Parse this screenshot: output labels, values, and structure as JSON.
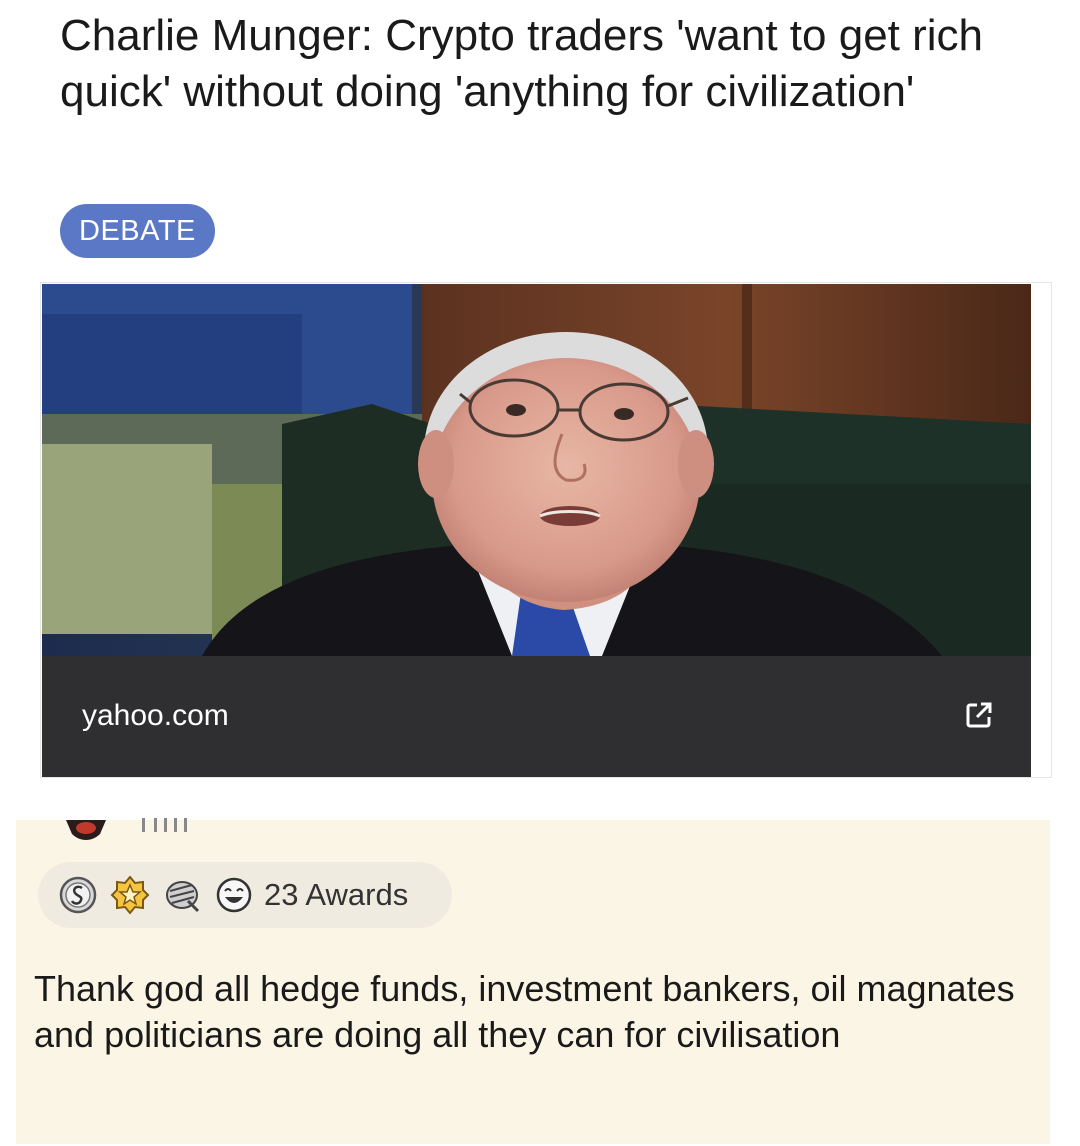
{
  "post": {
    "title": "Charlie Munger: Crypto traders 'want to get rich quick' without doing 'anything for civilization'",
    "flair": "DEBATE",
    "link": {
      "domain": "yahoo.com",
      "external_icon": "external-link-icon",
      "thumbnail": "photo of an older man in glasses, suit and blue tie"
    }
  },
  "comment": {
    "awards": {
      "icons": [
        "silver-award-icon",
        "gold-star-award-icon",
        "facepalm-award-icon",
        "laughing-face-award-icon"
      ],
      "count_label": "23 Awards"
    },
    "body": "Thank god  all hedge funds, investment bankers, oil magnates and politicians are doing all they can for civilisation"
  },
  "colors": {
    "flair_bg": "#5b78c6",
    "link_bar_bg": "#2f2f31",
    "comment_bg": "#fbf5e6",
    "awards_pill_bg": "#f0ebe0"
  }
}
